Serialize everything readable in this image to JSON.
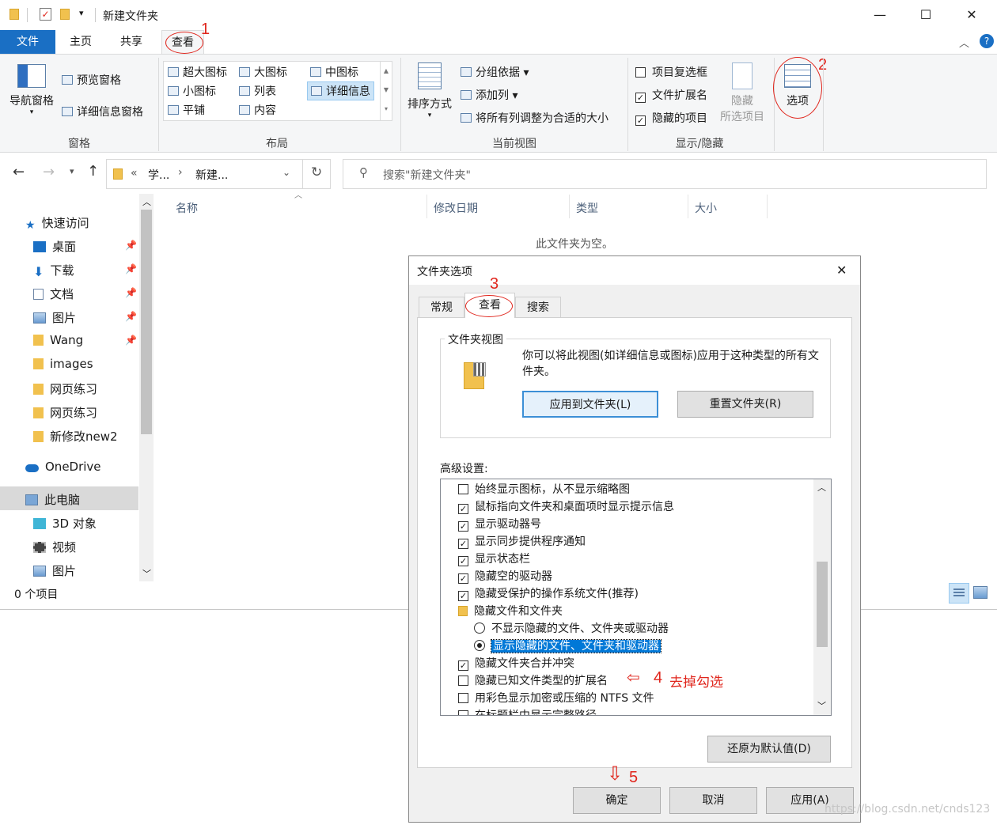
{
  "window": {
    "title": "新建文件夹",
    "minimize": "—",
    "maximize": "☐",
    "close": "✕"
  },
  "ribbon_tabs": [
    "文件",
    "主页",
    "共享",
    "查看"
  ],
  "ribbon": {
    "panes": {
      "nav_pane": "导航窗格",
      "preview_pane": "预览窗格",
      "details_pane": "详细信息窗格",
      "group_label": "窗格"
    },
    "layout": {
      "items": [
        "超大图标",
        "大图标",
        "中图标",
        "小图标",
        "列表",
        "详细信息",
        "平铺",
        "内容"
      ],
      "group_label": "布局"
    },
    "current_view": {
      "sort_by": "排序方式",
      "group_by": "分组依据",
      "add_column": "添加列",
      "fit_columns": "将所有列调整为合适的大小",
      "group_label": "当前视图"
    },
    "show_hide": {
      "item_checkboxes": "项目复选框",
      "file_extensions": "文件扩展名",
      "hidden_items": "隐藏的项目",
      "hide_selected_1": "隐藏",
      "hide_selected_2": "所选项目",
      "group_label": "显示/隐藏"
    },
    "options": "选项"
  },
  "annotations": {
    "n1": "1",
    "n2": "2",
    "n3": "3",
    "n4": "4",
    "n5": "5",
    "note4": "去掉勾选",
    "arrow4": "⇦",
    "arrow5": "⇩"
  },
  "address": {
    "path1": "学...",
    "path2": "新建...",
    "prefix": "«",
    "search_placeholder": "搜索\"新建文件夹\""
  },
  "columns": [
    "名称",
    "修改日期",
    "类型",
    "大小"
  ],
  "empty_message": "此文件夹为空。",
  "sidebar": {
    "quick_access": "快速访问",
    "items": [
      "桌面",
      "下载",
      "文档",
      "图片",
      "Wang",
      "images",
      "网页练习",
      "网页练习",
      "新修改new2"
    ],
    "onedrive": "OneDrive",
    "this_pc": "此电脑",
    "pc_items": [
      "3D 对象",
      "视频",
      "图片"
    ]
  },
  "status": {
    "count": "0 个项目"
  },
  "dialog": {
    "title": "文件夹选项",
    "close": "✕",
    "tabs": [
      "常规",
      "查看",
      "搜索"
    ],
    "folder_views": {
      "legend": "文件夹视图",
      "desc": "你可以将此视图(如详细信息或图标)应用于这种类型的所有文件夹。",
      "apply": "应用到文件夹(L)",
      "reset": "重置文件夹(R)"
    },
    "advanced_label": "高级设置:",
    "advanced": [
      {
        "label": "始终显示图标，从不显示缩略图",
        "kind": "check",
        "checked": false
      },
      {
        "label": "鼠标指向文件夹和桌面项时显示提示信息",
        "kind": "check",
        "checked": true
      },
      {
        "label": "显示驱动器号",
        "kind": "check",
        "checked": true
      },
      {
        "label": "显示同步提供程序通知",
        "kind": "check",
        "checked": true
      },
      {
        "label": "显示状态栏",
        "kind": "check",
        "checked": true
      },
      {
        "label": "隐藏空的驱动器",
        "kind": "check",
        "checked": true
      },
      {
        "label": "隐藏受保护的操作系统文件(推荐)",
        "kind": "check",
        "checked": true
      },
      {
        "label": "隐藏文件和文件夹",
        "kind": "folder",
        "checked": false
      },
      {
        "label": "不显示隐藏的文件、文件夹或驱动器",
        "kind": "radio",
        "checked": false
      },
      {
        "label": "显示隐藏的文件、文件夹和驱动器",
        "kind": "radio",
        "checked": true
      },
      {
        "label": "隐藏文件夹合并冲突",
        "kind": "check",
        "checked": true
      },
      {
        "label": "隐藏已知文件类型的扩展名",
        "kind": "check",
        "checked": false
      },
      {
        "label": "用彩色显示加密或压缩的 NTFS 文件",
        "kind": "check",
        "checked": false
      },
      {
        "label": "在标题栏中显示完整路径",
        "kind": "check",
        "checked": false
      }
    ],
    "restore": "还原为默认值(D)",
    "ok": "确定",
    "cancel": "取消",
    "apply": "应用(A)"
  },
  "watermark": "https://blog.csdn.net/cnds123"
}
